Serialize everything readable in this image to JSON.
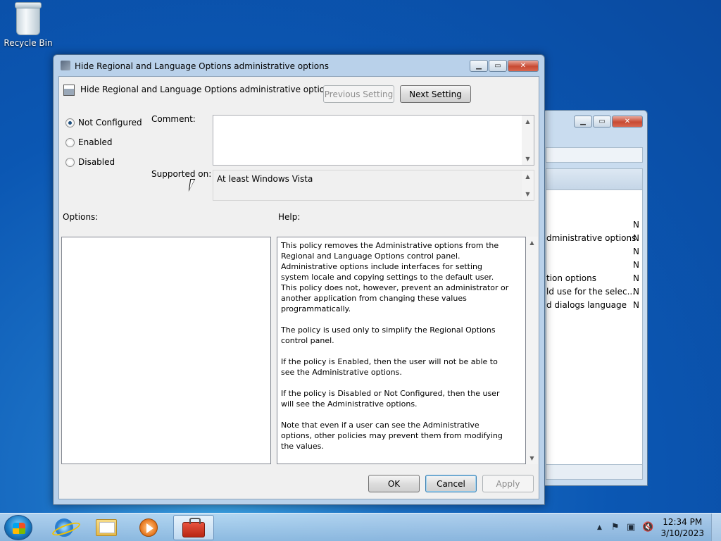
{
  "desktop": {
    "recycle_bin_label": "Recycle Bin"
  },
  "background_window": {
    "rows": [
      {
        "text": "",
        "status": "N"
      },
      {
        "text": "dministrative options",
        "status": "N"
      },
      {
        "text": "",
        "status": "N"
      },
      {
        "text": "",
        "status": "N"
      },
      {
        "text": "tion options",
        "status": "N"
      },
      {
        "text": "ld use for the selec...",
        "status": "N"
      },
      {
        "text": "d dialogs language",
        "status": "N"
      }
    ]
  },
  "dialog": {
    "window_title": "Hide Regional and Language Options administrative options",
    "header_title": "Hide Regional and Language Options administrative options",
    "previous_setting_label": "Previous Setting",
    "next_setting_label": "Next Setting",
    "radio_options": [
      {
        "label": "Not Configured",
        "checked": true
      },
      {
        "label": "Enabled",
        "checked": false
      },
      {
        "label": "Disabled",
        "checked": false
      }
    ],
    "comment_label": "Comment:",
    "comment_value": "",
    "supported_on_label": "Supported on:",
    "supported_on_value": "At least Windows Vista",
    "options_label": "Options:",
    "help_label": "Help:",
    "help_paragraphs": [
      "This policy removes the Administrative options from the Regional and Language Options control panel.  Administrative options include interfaces for setting system locale and copying settings to the default user. This policy does not, however, prevent an administrator or another application from changing these values programmatically.",
      "The policy is used only to simplify the Regional Options control panel.",
      "If the policy is Enabled, then the user will not be able to see the Administrative options.",
      "If the policy is Disabled or Not Configured, then the user will see the Administrative options.",
      "Note that even if a user can see the Administrative options, other policies may prevent them from modifying the values."
    ],
    "ok_label": "OK",
    "cancel_label": "Cancel",
    "apply_label": "Apply"
  },
  "taskbar": {
    "time": "12:34 PM",
    "date": "3/10/2023"
  },
  "icons": {
    "minimize": "minimize-icon",
    "maximize": "maximize-icon",
    "close": "close-icon"
  }
}
